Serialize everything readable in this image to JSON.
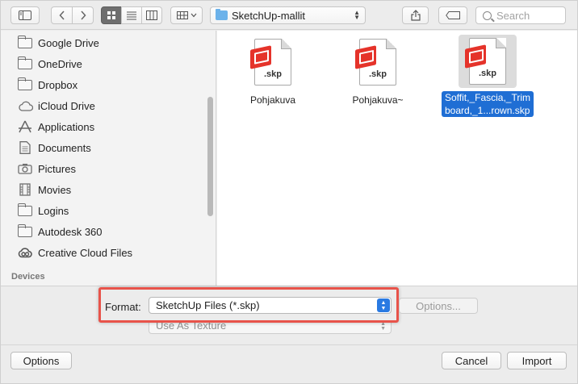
{
  "toolbar": {
    "location": "SketchUp-mallit",
    "search_placeholder": "Search"
  },
  "sidebar": {
    "items": [
      {
        "label": "Google Drive",
        "icon": "folder-icon"
      },
      {
        "label": "OneDrive",
        "icon": "folder-icon"
      },
      {
        "label": "Dropbox",
        "icon": "folder-icon"
      },
      {
        "label": "iCloud Drive",
        "icon": "cloud-icon"
      },
      {
        "label": "Applications",
        "icon": "applications-icon"
      },
      {
        "label": "Documents",
        "icon": "documents-icon"
      },
      {
        "label": "Pictures",
        "icon": "camera-icon"
      },
      {
        "label": "Movies",
        "icon": "film-icon"
      },
      {
        "label": "Logins",
        "icon": "folder-icon"
      },
      {
        "label": "Autodesk 360",
        "icon": "folder-icon"
      },
      {
        "label": "Creative Cloud Files",
        "icon": "creative-cloud-icon"
      }
    ],
    "section_devices": "Devices"
  },
  "files": [
    {
      "name": "Pohjakuva",
      "ext": ".skp",
      "selected": false
    },
    {
      "name": "Pohjakuva~",
      "ext": ".skp",
      "selected": false
    },
    {
      "name_line1": "Soffit,_Fascia,_Trim",
      "name_line2": "board,_1...rown.skp",
      "ext": ".skp",
      "selected": true
    }
  ],
  "accessory": {
    "format_label": "Format:",
    "format_value": "SketchUp Files (*.skp)",
    "options_label": "Options...",
    "texture_value": "Use As Texture"
  },
  "footer": {
    "options_button": "Options",
    "cancel_button": "Cancel",
    "import_button": "Import"
  },
  "colors": {
    "selection": "#1f6ed4",
    "highlight_frame": "#e8534a",
    "popup_accent": "#2a7ae2"
  }
}
